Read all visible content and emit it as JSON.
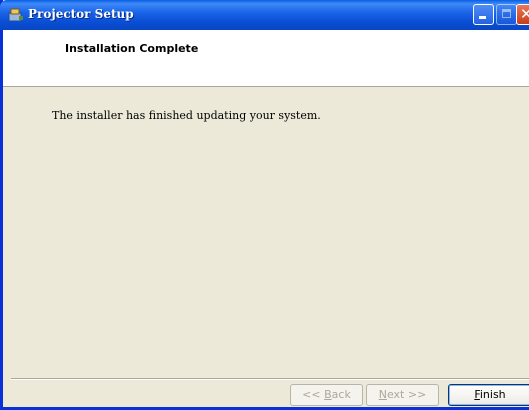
{
  "window": {
    "title": "Projector Setup",
    "icon": "setup-app-icon",
    "controls": {
      "minimize": "minimize-icon",
      "maximize": "maximize-icon",
      "close": "close-icon"
    }
  },
  "header": {
    "title": "Installation Complete"
  },
  "main": {
    "message": "The installer has finished updating your system."
  },
  "buttons": {
    "back": {
      "prefix": "<< ",
      "accel": "B",
      "rest": "ack",
      "enabled": false
    },
    "next": {
      "accel": "N",
      "rest": "ext >>",
      "enabled": false
    },
    "finish": {
      "accel": "F",
      "rest": "inish",
      "enabled": true
    }
  },
  "colors": {
    "titlebar": "#0A50D6",
    "window_bg": "#ECE9D8",
    "header_bg": "#FFFFFF",
    "close": "#C93E19"
  }
}
